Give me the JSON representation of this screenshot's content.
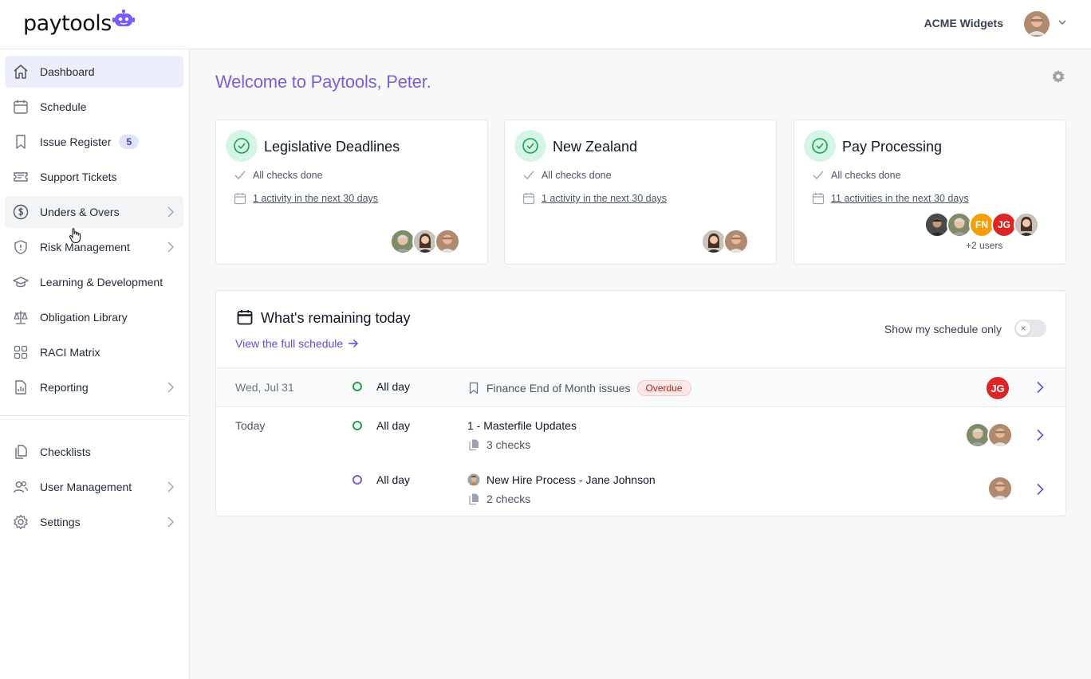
{
  "brand": {
    "name": "paytools",
    "accent": "#7c5fd6",
    "bot_color": "#7a5af8"
  },
  "header": {
    "org_name": "ACME Widgets"
  },
  "sidebar": {
    "items": [
      {
        "label": "Dashboard",
        "icon": "home-icon",
        "active": true
      },
      {
        "label": "Schedule",
        "icon": "calendar-icon"
      },
      {
        "label": "Issue Register",
        "icon": "bookmark-icon",
        "badge": "5"
      },
      {
        "label": "Support Tickets",
        "icon": "ticket-icon"
      },
      {
        "label": "Unders & Overs",
        "icon": "dollar-circle-icon",
        "chevron": true
      },
      {
        "label": "Risk Management",
        "icon": "shield-icon",
        "chevron": true
      },
      {
        "label": "Learning & Development",
        "icon": "graduation-cap-icon"
      },
      {
        "label": "Obligation Library",
        "icon": "scales-icon"
      },
      {
        "label": "RACI Matrix",
        "icon": "grid-icon"
      },
      {
        "label": "Reporting",
        "icon": "report-icon",
        "chevron": true
      },
      {
        "label": "Checklists",
        "icon": "documents-icon"
      },
      {
        "label": "User Management",
        "icon": "users-icon",
        "chevron": true
      },
      {
        "label": "Settings",
        "icon": "gear-icon",
        "chevron": true
      }
    ]
  },
  "main": {
    "welcome": "Welcome to Paytools, Peter.",
    "cards": [
      {
        "title": "Legislative Deadlines",
        "status": "All checks done",
        "activity": "1 activity in the next 30 days"
      },
      {
        "title": "New Zealand",
        "status": "All checks done",
        "activity": "1 activity in the next 30 days"
      },
      {
        "title": "Pay Processing",
        "status": "All checks done",
        "activity": "11 activities in the next 30 days",
        "initials": [
          "FN",
          "JG"
        ],
        "extra_users": "+2 users"
      }
    ],
    "remaining": {
      "title": "What's remaining today",
      "link": "View the full schedule",
      "toggle_label": "Show my schedule only",
      "rows": [
        {
          "date": "Wed, Jul 31",
          "time": "All day",
          "title": "Finance End of Month issues",
          "tag": "Overdue",
          "assignee_initials": "JG"
        },
        {
          "date": "Today",
          "time": "All day",
          "title": "1 - Masterfile Updates",
          "sub": "3 checks"
        },
        {
          "date": "",
          "time": "All day",
          "title": "New Hire Process - Jane Johnson",
          "sub": "2 checks"
        }
      ]
    }
  },
  "colors": {
    "success_green": "#16a34a",
    "overdue_red": "#b42318",
    "fn_orange": "#f59e0b",
    "jg_red": "#dc2626"
  }
}
